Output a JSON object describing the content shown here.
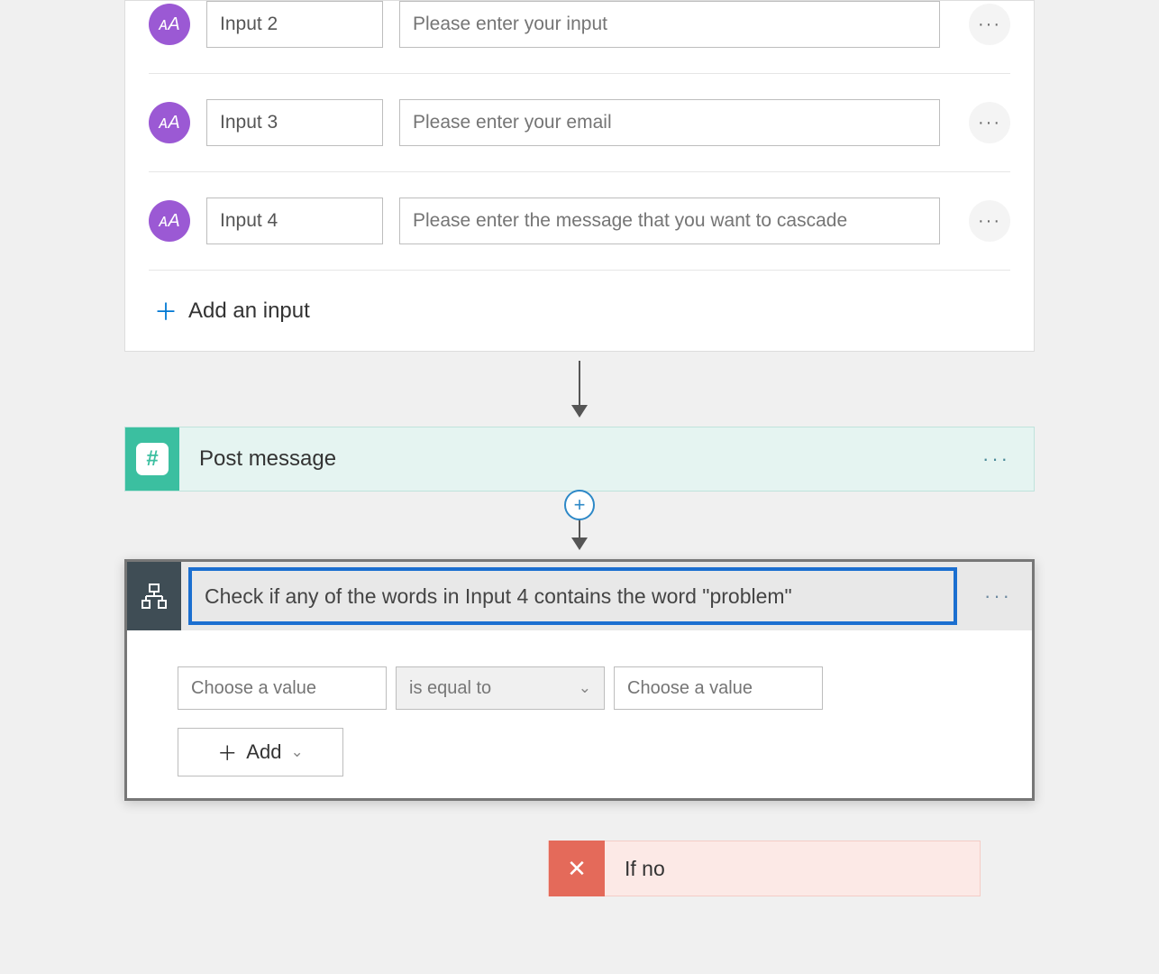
{
  "trigger_card": {
    "inputs": [
      {
        "name": "Input 2",
        "placeholder": "Please enter your input"
      },
      {
        "name": "Input 3",
        "placeholder": "Please enter your email"
      },
      {
        "name": "Input 4",
        "placeholder": "Please enter the message that you want to cascade"
      }
    ],
    "add_input_label": "Add an input",
    "text_icon_glyph": "ᴀA"
  },
  "post_step": {
    "title": "Post message",
    "hash_glyph": "#"
  },
  "insert_plus": "+",
  "condition": {
    "title": "Check if any of the words in Input 4 contains the word \"problem\"",
    "left_placeholder": "Choose a value",
    "operator_label": "is equal to",
    "right_placeholder": "Choose a value",
    "add_label": "Add"
  },
  "branch": {
    "no_label": "If no",
    "x_glyph": "✕"
  },
  "ellipsis": "···"
}
